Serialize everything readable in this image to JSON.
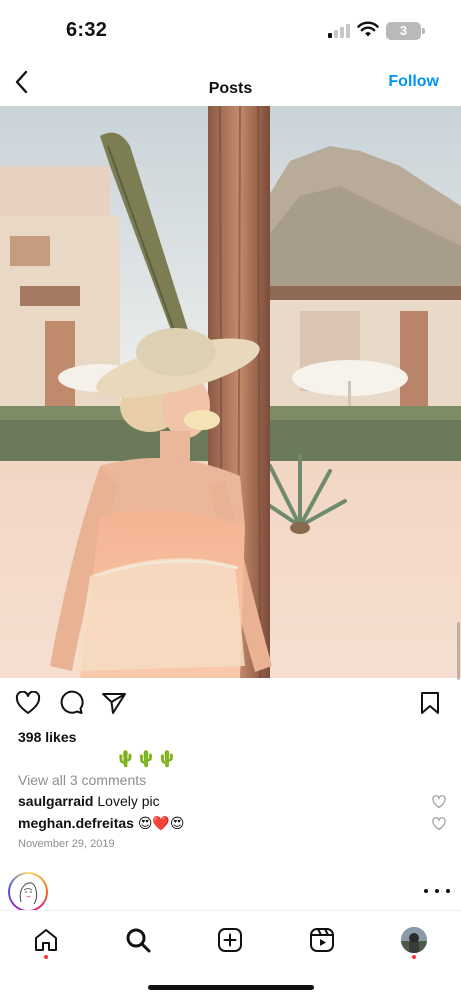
{
  "status_bar": {
    "time": "6:32",
    "battery": "3"
  },
  "header": {
    "title": "Posts",
    "follow_label": "Follow"
  },
  "post": {
    "likes": "398 likes",
    "caption": "🌵🌵🌵",
    "view_comments": "View all 3 comments",
    "comments": [
      {
        "user": "saulgarraid",
        "text": "Lovely pic"
      },
      {
        "user": "meghan.defreitas",
        "text": "😍❤️😍"
      }
    ],
    "date": "November 29, 2019"
  },
  "icons": {
    "back": "chevron-left-icon",
    "like": "heart-icon",
    "comment": "comment-icon",
    "share": "paper-plane-icon",
    "save": "bookmark-icon",
    "more": "more-horizontal-icon"
  },
  "tab_bar": {
    "tabs": [
      "home",
      "search",
      "create",
      "reels",
      "profile"
    ],
    "active": "search"
  },
  "colors": {
    "accent": "#0095f6",
    "notification": "#ff3040",
    "muted_text": "#8e8e8e"
  }
}
